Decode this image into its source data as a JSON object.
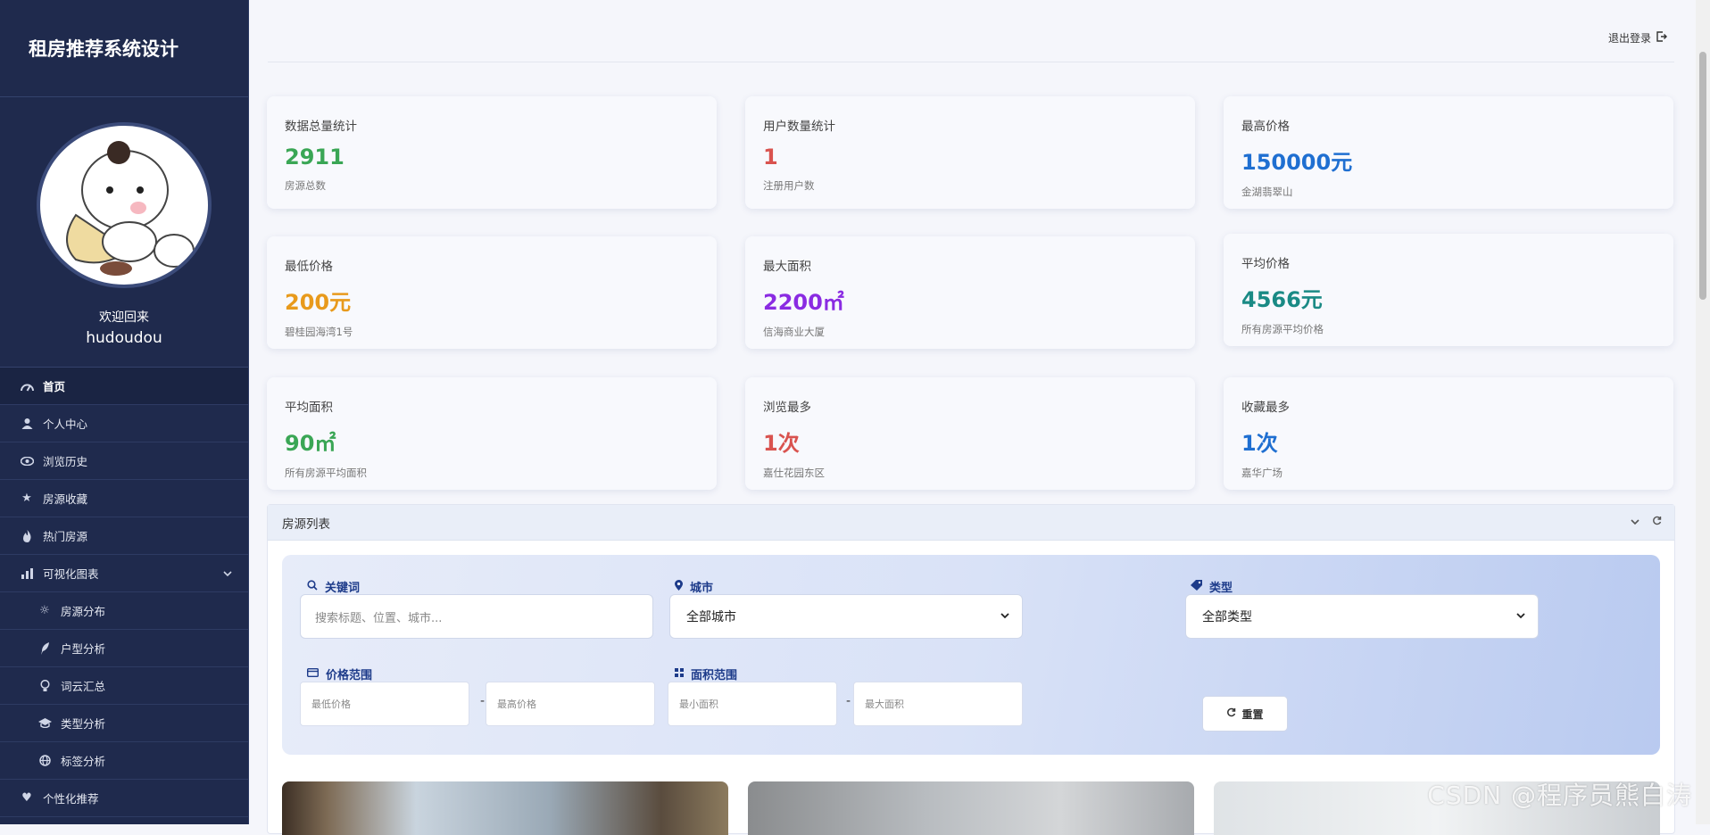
{
  "brand": "租房推荐系统设计",
  "profile": {
    "welcome": "欢迎回来",
    "username": "hudoudou"
  },
  "nav": [
    {
      "label": "首页",
      "icon": "dashboard-icon",
      "active": true
    },
    {
      "label": "个人中心",
      "icon": "user-icon"
    },
    {
      "label": "浏览历史",
      "icon": "eye-icon"
    },
    {
      "label": "房源收藏",
      "icon": "star-icon"
    },
    {
      "label": "热门房源",
      "icon": "fire-icon"
    },
    {
      "label": "可视化图表",
      "icon": "bar-chart-icon",
      "expanded": true
    },
    {
      "label": "房源分布",
      "icon": "sun-icon",
      "sub": true
    },
    {
      "label": "户型分析",
      "icon": "feather-icon",
      "sub": true
    },
    {
      "label": "词云汇总",
      "icon": "bulb-icon",
      "sub": true
    },
    {
      "label": "类型分析",
      "icon": "graduation-icon",
      "sub": true
    },
    {
      "label": "标签分析",
      "icon": "globe-icon",
      "sub": true
    },
    {
      "label": "个性化推荐",
      "icon": "heart-icon"
    }
  ],
  "topbar": {
    "logout": "退出登录"
  },
  "stats": [
    {
      "title": "数据总量统计",
      "value": "2911",
      "desc": "房源总数",
      "color": "#3aa655"
    },
    {
      "title": "用户数量统计",
      "value": "1",
      "desc": "注册用户数",
      "color": "#d9534f"
    },
    {
      "title": "最高价格",
      "value": "150000元",
      "desc": "金湖翡翠山",
      "color": "#1f6fd1"
    },
    {
      "title": "最低价格",
      "value": "200元",
      "desc": "碧桂园海湾1号",
      "color": "#e89a1c"
    },
    {
      "title": "最大面积",
      "value": "2200㎡",
      "desc": "信海商业大厦",
      "color": "#8a2be2"
    },
    {
      "title": "平均价格",
      "value": "4566元",
      "desc": "所有房源平均价格",
      "color": "#1a8a85"
    },
    {
      "title": "平均面积",
      "value": "90㎡",
      "desc": "所有房源平均面积",
      "color": "#3aa655"
    },
    {
      "title": "浏览最多",
      "value": "1次",
      "desc": "嘉仕花园东区",
      "color": "#d9534f"
    },
    {
      "title": "收藏最多",
      "value": "1次",
      "desc": "嘉华广场",
      "color": "#1f6fd1"
    }
  ],
  "panel": {
    "title": "房源列表",
    "filters": {
      "keyword_label": "关键词",
      "keyword_placeholder": "搜索标题、位置、城市...",
      "city_label": "城市",
      "city_value": "全部城市",
      "type_label": "类型",
      "type_value": "全部类型",
      "price_label": "价格范围",
      "price_min": "最低价格",
      "price_max": "最高价格",
      "area_label": "面积范围",
      "area_min": "最小面积",
      "area_max": "最大面积",
      "reset": "重置"
    }
  },
  "watermark": "CSDN @程序员熊白涛"
}
